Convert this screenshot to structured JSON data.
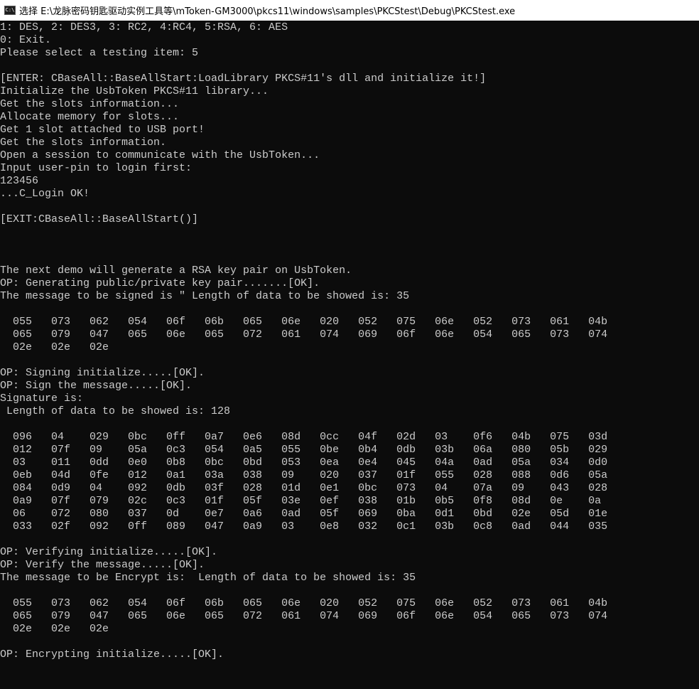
{
  "window": {
    "title": "选择 E:\\龙脉密码钥匙驱动实例工具等\\mToken-GM3000\\pkcs11\\windows\\samples\\PKCStest\\Debug\\PKCStest.exe",
    "icon": "console-app-icon",
    "icon_glyph": "C:\\"
  },
  "console": {
    "colors": {
      "background": "#0c0c0c",
      "text": "#cccccc"
    },
    "lines": [
      "1: DES, 2: DES3, 3: RC2, 4:RC4, 5:RSA, 6: AES",
      "0: Exit.",
      "Please select a testing item: 5",
      "",
      "[ENTER: CBaseAll::BaseAllStart:LoadLibrary PKCS#11's dll and initialize it!]",
      "Initialize the UsbToken PKCS#11 library...",
      "Get the slots information...",
      "Allocate memory for slots...",
      "Get 1 slot attached to USB port!",
      "Get the slots information.",
      "Open a session to communicate with the UsbToken...",
      "Input user-pin to login first:",
      "123456",
      "...C_Login OK!",
      "",
      "[EXIT:CBaseAll::BaseAllStart()]",
      "",
      "",
      "",
      "The next demo will generate a RSA key pair on UsbToken.",
      "OP: Generating public/private key pair.......[OK].",
      "The message to be signed is \" Length of data to be showed is: 35",
      "",
      "  055   073   062   054   06f   06b   065   06e   020   052   075   06e   052   073   061   04b",
      "  065   079   047   065   06e   065   072   061   074   069   06f   06e   054   065   073   074",
      "  02e   02e   02e",
      "",
      "OP: Signing initialize.....[OK].",
      "OP: Sign the message.....[OK].",
      "Signature is:",
      " Length of data to be showed is: 128",
      "",
      "  096   04    029   0bc   0ff   0a7   0e6   08d   0cc   04f   02d   03    0f6   04b   075   03d",
      "  012   07f   09    05a   0c3   054   0a5   055   0be   0b4   0db   03b   06a   080   05b   029",
      "  03    011   0dd   0e0   0b8   0bc   0bd   053   0ea   0e4   045   04a   0ad   05a   034   0d0",
      "  0eb   04d   0fe   012   0a1   03a   038   09    020   037   01f   055   028   088   0d6   05a",
      "  084   0d9   04    092   0db   03f   028   01d   0e1   0bc   073   04    07a   09    043   028",
      "  0a9   07f   079   02c   0c3   01f   05f   03e   0ef   038   01b   0b5   0f8   08d   0e    0a",
      "  06    072   080   037   0d    0e7   0a6   0ad   05f   069   0ba   0d1   0bd   02e   05d   01e",
      "  033   02f   092   0ff   089   047   0a9   03    0e8   032   0c1   03b   0c8   0ad   044   035",
      "",
      "OP: Verifying initialize.....[OK].",
      "OP: Verify the message.....[OK].",
      "The message to be Encrypt is:  Length of data to be showed is: 35",
      "",
      "  055   073   062   054   06f   06b   065   06e   020   052   075   06e   052   073   061   04b",
      "  065   079   047   065   06e   065   072   061   074   069   06f   06e   054   065   073   074",
      "  02e   02e   02e",
      "",
      "OP: Encrypting initialize.....[OK]."
    ]
  }
}
